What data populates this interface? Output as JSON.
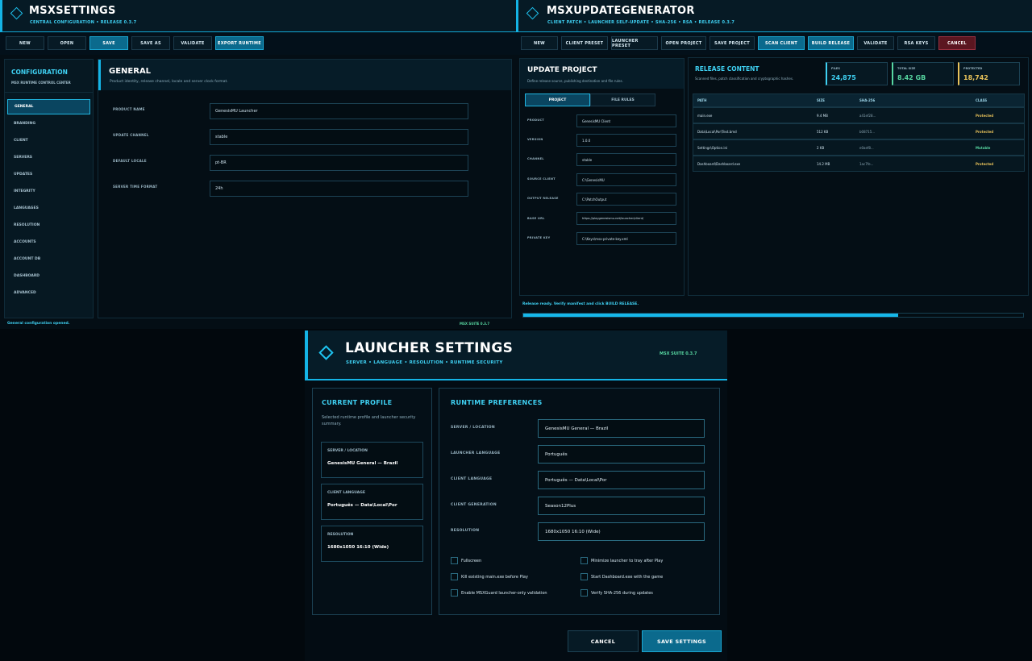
{
  "msxsettings": {
    "title": "MSXSETTINGS",
    "subtitle": "CENTRAL CONFIGURATION • RELEASE 0.3.7",
    "toolbar": [
      "NEW",
      "OPEN",
      "SAVE",
      "SAVE AS",
      "VALIDATE",
      "EXPORT RUNTIME"
    ],
    "sidebar": {
      "title": "CONFIGURATION",
      "subtitle": "MSX RUNTIME CONTROL CENTER",
      "items": [
        "GENERAL",
        "BRANDING",
        "CLIENT",
        "SERVERS",
        "UPDATES",
        "INTEGRITY",
        "LANGUAGES",
        "RESOLUTION",
        "ACCOUNTS",
        "ACCOUNT DB",
        "DASHBOARD",
        "ADVANCED"
      ]
    },
    "main": {
      "title": "GENERAL",
      "description": "Product identity, release channel, locale and server clock format.",
      "fields": [
        {
          "label": "PRODUCT NAME",
          "value": "GenesisMU Launcher"
        },
        {
          "label": "UPDATE CHANNEL",
          "value": "stable"
        },
        {
          "label": "DEFAULT LOCALE",
          "value": "pt-BR"
        },
        {
          "label": "SERVER TIME FORMAT",
          "value": "24h"
        }
      ]
    },
    "status": "General configuration opened.",
    "version": "MSX SUITE 0.3.7"
  },
  "msxupdategenerator": {
    "title": "MSXUPDATEGENERATOR",
    "subtitle": "CLIENT PATCH • LAUNCHER SELF-UPDATE • SHA-256 • RSA • RELEASE 0.3.7",
    "toolbar": [
      "NEW",
      "CLIENT PRESET",
      "LAUNCHER PRESET",
      "OPEN PROJECT",
      "SAVE PROJECT",
      "SCAN CLIENT",
      "BUILD RELEASE",
      "VALIDATE",
      "RSA KEYS",
      "CANCEL"
    ],
    "project": {
      "title": "UPDATE PROJECT",
      "description": "Define release source, publishing destination and file rules.",
      "tabs": [
        "PROJECT",
        "FILE RULES"
      ],
      "fields": [
        {
          "label": "PRODUCT",
          "value": "GenesisMU Client"
        },
        {
          "label": "VERSION",
          "value": "1.0.0"
        },
        {
          "label": "CHANNEL",
          "value": "stable"
        },
        {
          "label": "SOURCE CLIENT",
          "value": "C:\\GenesisMU"
        },
        {
          "label": "OUTPUT RELEASE",
          "value": "C:\\PatchOutput"
        },
        {
          "label": "BASE URL",
          "value": "https://playgenesismu.net/launcher/client/"
        },
        {
          "label": "PRIVATE KEY",
          "value": "C:\\Keys\\msx-private-key.xml"
        }
      ]
    },
    "release": {
      "title": "RELEASE CONTENT",
      "description": "Scanned files, patch classification and cryptographic hashes.",
      "stats": [
        {
          "label": "FILES",
          "value": "24,875",
          "color": "#3fd1f3"
        },
        {
          "label": "TOTAL SIZE",
          "value": "8.42 GB",
          "color": "#57d6a1"
        },
        {
          "label": "PROTECTED",
          "value": "18,742",
          "color": "#e8c25a"
        }
      ],
      "columns": [
        "PATH",
        "SIZE",
        "SHA-256",
        "CLASS"
      ],
      "rows": [
        [
          "main.exe",
          "9.4 MB",
          "a41ef28...",
          "Protected"
        ],
        [
          "Data\\Local\\Por\\Text.bmd",
          "512 KB",
          "b08715...",
          "Protected"
        ],
        [
          "Settings\\Option.ini",
          "2 KB",
          "e0aef8...",
          "Mutable"
        ],
        [
          "Dashboard\\Dashboard.exe",
          "14.2 MB",
          "1ac7fe...",
          "Protected"
        ]
      ]
    },
    "status": "Release ready. Verify manifest and click BUILD RELEASE.",
    "progress": 0.75
  },
  "launcher": {
    "title": "LAUNCHER SETTINGS",
    "subtitle": "SERVER • LANGUAGE • RESOLUTION • RUNTIME SECURITY",
    "version": "MSX SUITE 0.3.7",
    "profile": {
      "title": "CURRENT PROFILE",
      "description": "Selected runtime profile and launcher security summary.",
      "cards": [
        {
          "label": "SERVER / LOCATION",
          "value": "GenesisMU General — Brazil"
        },
        {
          "label": "CLIENT LANGUAGE",
          "value": "Português — Data\\Local\\Por"
        },
        {
          "label": "RESOLUTION",
          "value": "1680x1050 16:10 (Wide)"
        }
      ]
    },
    "prefs": {
      "title": "RUNTIME PREFERENCES",
      "fields": [
        {
          "label": "SERVER / LOCATION",
          "value": "GenesisMU General — Brazil"
        },
        {
          "label": "LAUNCHER LANGUAGE",
          "value": "Português"
        },
        {
          "label": "CLIENT LANGUAGE",
          "value": "Português — Data\\Local\\Por"
        },
        {
          "label": "CLIENT GENERATION",
          "value": "Season12Plus"
        },
        {
          "label": "RESOLUTION",
          "value": "1680x1050 16:10 (Wide)"
        }
      ],
      "checkboxes": [
        "Fullscreen",
        "Minimize launcher to tray after Play",
        "Kill existing main.exe before Play",
        "Start Dashboard.exe with the game",
        "Enable MSXGuard launcher-only validation",
        "Verify SHA-256 during updates"
      ]
    },
    "cancel_label": "CANCEL",
    "save_label": "SAVE SETTINGS"
  }
}
